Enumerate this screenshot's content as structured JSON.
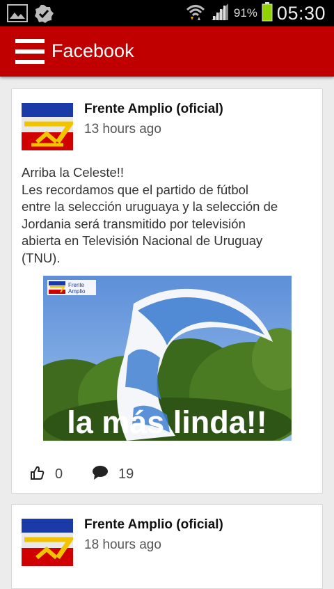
{
  "status_bar": {
    "battery_percent": "91%",
    "time": "05:30",
    "icons": [
      "image-icon",
      "check-badge-icon",
      "wifi-icon",
      "signal-icon",
      "battery-icon"
    ]
  },
  "app_bar": {
    "title": "Facebook",
    "menu_icon": "hamburger-menu-icon",
    "color": "#c00000"
  },
  "posts": [
    {
      "author": "Frente Amplio (oficial)",
      "time": "13 hours ago",
      "text_lines": [
        "Arriba la Celeste!!",
        "Les recordamos que el partido de fútbol",
        "entre la selección uruguaya y la selección de",
        "Jordania será transmitido por televisión",
        "abierta en Televisión Nacional de Uruguay",
        "(TNU)."
      ],
      "image": {
        "logo_text_line1": "Frente",
        "logo_text_line2": "Amplio",
        "caption": "la más linda!!"
      },
      "likes": "0",
      "comments": "19"
    },
    {
      "author": "Frente Amplio (oficial)",
      "time": "18 hours ago"
    }
  ]
}
